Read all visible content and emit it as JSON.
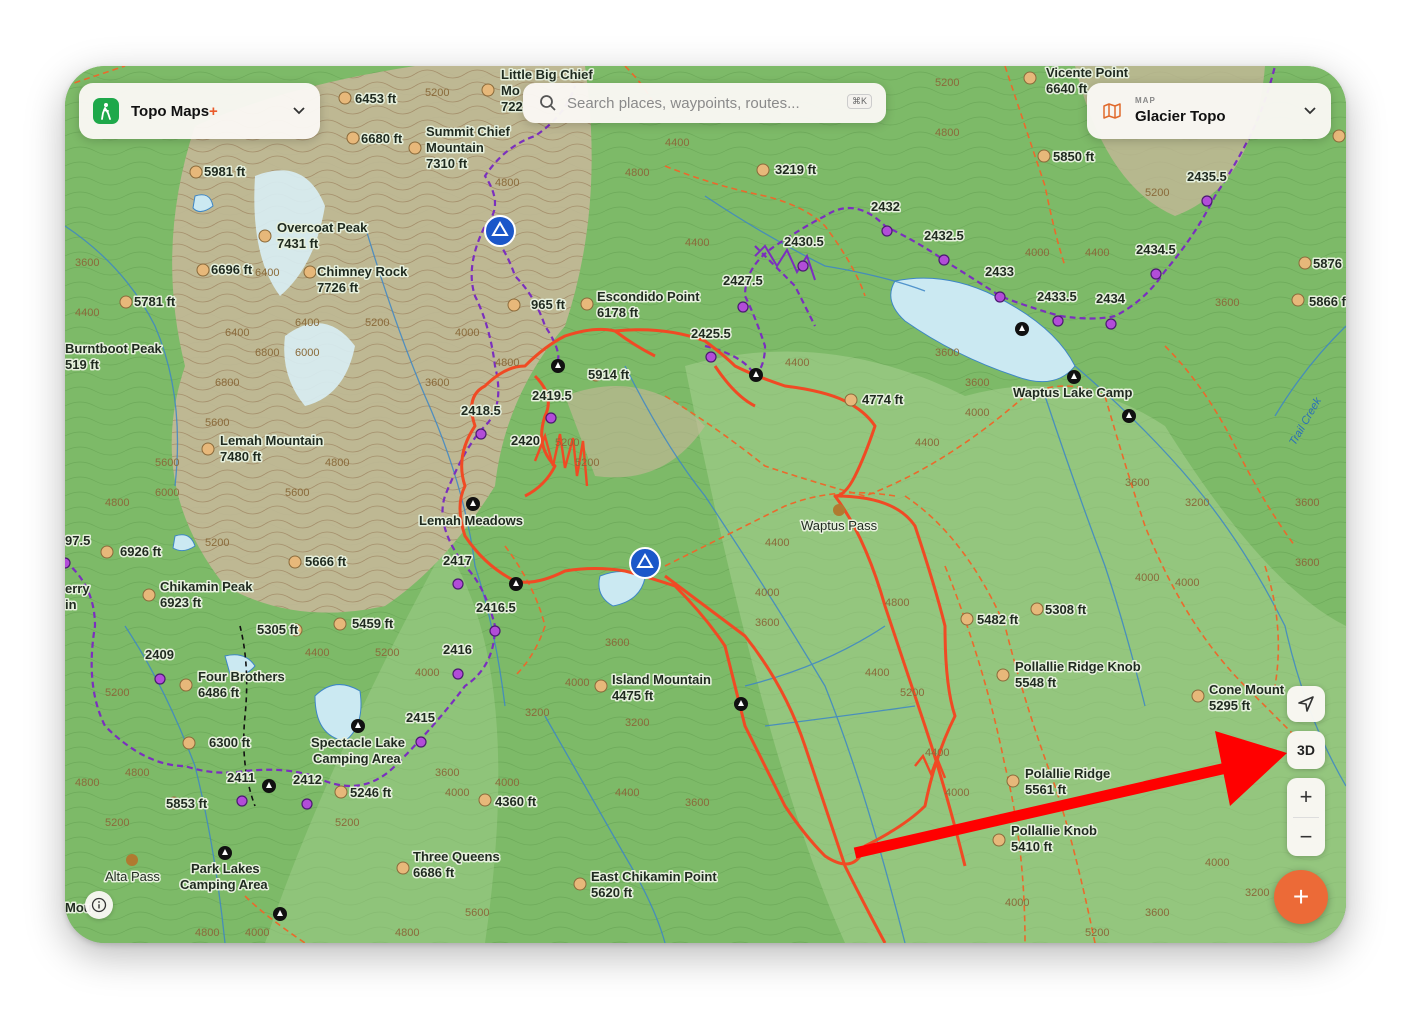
{
  "app_switcher": {
    "name": "Topo Maps",
    "plus": "+"
  },
  "search": {
    "placeholder": "Search places, waypoints, routes...",
    "shortcut": "⌘K"
  },
  "map_selector": {
    "caption": "MAP",
    "name": "Glacier Topo"
  },
  "controls": {
    "three_d_label": "3D",
    "zoom_in": "+",
    "zoom_out": "−",
    "add": "+"
  },
  "colors": {
    "route": "#f04a24",
    "trail_purple": "#7b2fbe",
    "trail_orange": "#ea6a2c",
    "water": "#cbe9f2",
    "stream": "#3d86c6",
    "accent": "#ec6a37",
    "annotation_arrow": "#ff0000"
  },
  "icons": [
    "hiker-icon",
    "search-icon",
    "map-icon",
    "chevron-down-icon",
    "locate-arrow-icon",
    "info-icon",
    "campsite-icon",
    "summit-icon",
    "pass-icon"
  ],
  "peaks": [
    {
      "name": "Little Big Chief",
      "name2": "Mo",
      "elev": "722"
    },
    {
      "name": "6453 ft"
    },
    {
      "name": "6680 ft"
    },
    {
      "name": "Summit Chief",
      "name2": "Mountain",
      "elev": "7310 ft"
    },
    {
      "name": "5981 ft"
    },
    {
      "name": "Overcoat Peak",
      "elev": "7431 ft"
    },
    {
      "name": "6696 ft"
    },
    {
      "name": "Chimney Rock",
      "elev": "7726 ft"
    },
    {
      "name": "5781 ft"
    },
    {
      "name": "Burntboot Peak",
      "elev": "519 ft"
    },
    {
      "name": "965 ft"
    },
    {
      "name": "Escondido Point",
      "elev": "6178 ft"
    },
    {
      "name": "3219 ft"
    },
    {
      "name": "5914 ft"
    },
    {
      "name": "4774 ft"
    },
    {
      "name": "Lemah Mountain",
      "elev": "7480 ft"
    },
    {
      "name": "6926 ft"
    },
    {
      "name": "5666 ft"
    },
    {
      "name": "Chikamin Peak",
      "elev": "6923 ft"
    },
    {
      "name": "5305 ft"
    },
    {
      "name": "5459 ft"
    },
    {
      "name": "Four Brothers",
      "elev": "6486 ft"
    },
    {
      "name": "6300 ft"
    },
    {
      "name": "5853 ft"
    },
    {
      "name": "5246 ft"
    },
    {
      "name": "4360 ft"
    },
    {
      "name": "Island Mountain",
      "elev": "4475 ft"
    },
    {
      "name": "Three Queens",
      "elev": "6686 ft"
    },
    {
      "name": "East Chikamin Point",
      "elev": "5620 ft"
    },
    {
      "name": "Vicente Point",
      "elev": "6640 ft"
    },
    {
      "name": "5850 ft"
    },
    {
      "name": "5876"
    },
    {
      "name": "5866 ft"
    },
    {
      "name": "5482 ft"
    },
    {
      "name": "5308 ft"
    },
    {
      "name": "Pollallie Ridge Knob",
      "elev": "5548 ft"
    },
    {
      "name": "Cone Mount",
      "elev": "5295 ft"
    },
    {
      "name": "Polallie Ridge",
      "elev": "5561 ft"
    },
    {
      "name": "Pollallie Knob",
      "elev": "5410 ft"
    }
  ],
  "places": {
    "lemah_meadows": "Lemah Meadows",
    "waptus_pass": "Waptus Pass",
    "waptus_lake_camp": "Waptus Lake Camp",
    "spectacle_lake": "Spectacle Lake",
    "camping_area": "Camping Area",
    "park_lakes": "Park Lakes",
    "alta_pass": "Alta Pass",
    "cherry_fragment": "erry",
    "in_fragment": "in",
    "mou_fragment": "Mou",
    "trail_creek": "Trail Creek"
  },
  "mile_markers": [
    "2418.5",
    "2419.5",
    "2420",
    "2417",
    "2416.5",
    "2416",
    "2415",
    "2411",
    "2412",
    "2409",
    "2427.5",
    "2430.5",
    "2425.5",
    "2432",
    "2432.5",
    "2433",
    "2433.5",
    "2434",
    "2434.5",
    "2435.5",
    "97.5"
  ]
}
